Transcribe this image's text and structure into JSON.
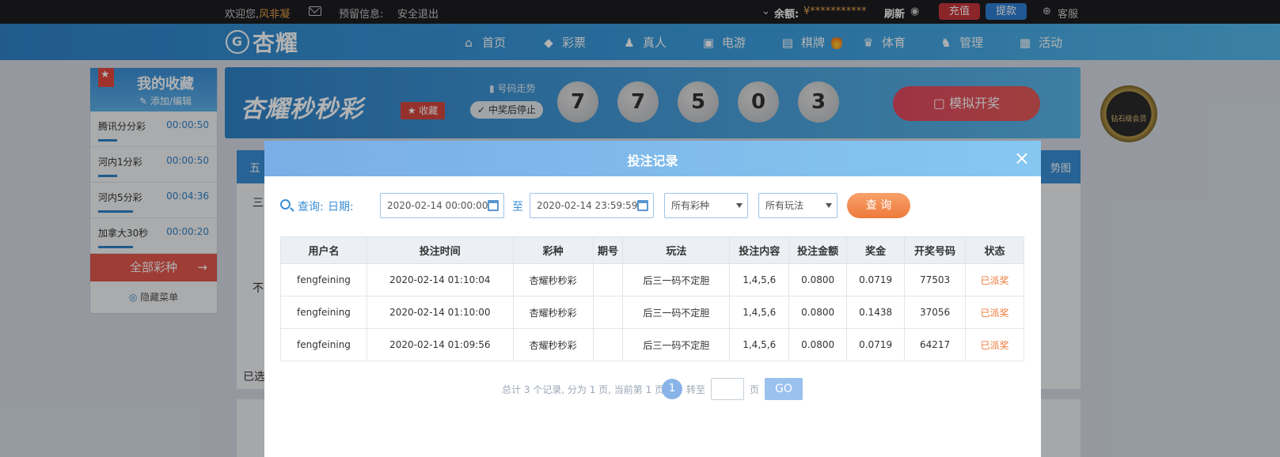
{
  "topbar": {
    "welcome": "欢迎您,",
    "username": "风非凝",
    "reserve_info": "预留信息:",
    "logout": "安全退出",
    "balance_label": "余额:",
    "balance_value": "¥***********",
    "refresh": "刷新",
    "recharge": "充值",
    "withdraw": "提款",
    "service": "客服"
  },
  "nav": {
    "logo": "杏耀",
    "items": [
      {
        "label": "首页",
        "icon": "home-icon"
      },
      {
        "label": "彩票",
        "icon": "lottery-icon"
      },
      {
        "label": "真人",
        "icon": "live-icon"
      },
      {
        "label": "电游",
        "icon": "slot-icon"
      },
      {
        "label": "棋牌",
        "icon": "card-icon"
      },
      {
        "label": "体育",
        "icon": "trophy-icon"
      },
      {
        "label": "管理",
        "icon": "users-icon"
      },
      {
        "label": "活动",
        "icon": "gift-icon"
      }
    ]
  },
  "favorites": {
    "title": "我的收藏",
    "edit": "添加/编辑",
    "items": [
      {
        "name": "腾讯分分彩",
        "time": "00:00:50"
      },
      {
        "name": "河内1分彩",
        "time": "00:00:50"
      },
      {
        "name": "河内5分彩",
        "time": "00:04:36"
      },
      {
        "name": "加拿大30秒",
        "time": "00:00:20"
      }
    ],
    "all_games": "全部彩种",
    "hide_menu": "隐藏菜单"
  },
  "banner": {
    "title": "杏耀秒秒彩",
    "fav_button": "收藏",
    "trend": "号码走势",
    "stop_toggle": "中奖后停止",
    "balls": [
      "7",
      "7",
      "5",
      "0",
      "3"
    ],
    "simulate": "模拟开奖",
    "vip_badge": "钻石级会员"
  },
  "background": {
    "tab_left": "五",
    "tab_right": "势图",
    "row1": "三",
    "row2": "不",
    "row3": "已选"
  },
  "modal": {
    "title": "投注记录",
    "close": "×",
    "filter": {
      "query_label": "查询:",
      "date_label": "日期:",
      "start": "2020-02-14 00:00:00",
      "to": "至",
      "end": "2020-02-14 23:59:59",
      "game_select": "所有彩种",
      "play_select": "所有玩法",
      "query_button": "查 询"
    },
    "table": {
      "headers": [
        "用户名",
        "投注时间",
        "彩种",
        "期号",
        "玩法",
        "投注内容",
        "投注金额",
        "奖金",
        "开奖号码",
        "状态"
      ],
      "rows": [
        [
          "fengfeining",
          "2020-02-14 01:10:04",
          "杏耀秒秒彩",
          "",
          "后三一码不定胆",
          "1,4,5,6",
          "0.0800",
          "0.0719",
          "77503",
          "已派奖"
        ],
        [
          "fengfeining",
          "2020-02-14 01:10:00",
          "杏耀秒秒彩",
          "",
          "后三一码不定胆",
          "1,4,5,6",
          "0.0800",
          "0.1438",
          "37056",
          "已派奖"
        ],
        [
          "fengfeining",
          "2020-02-14 01:09:56",
          "杏耀秒秒彩",
          "",
          "后三一码不定胆",
          "1,4,5,6",
          "0.0800",
          "0.0719",
          "64217",
          "已派奖"
        ]
      ]
    },
    "pager": {
      "summary": "总计 3 个记录, 分为 1 页, 当前第 1 页",
      "current": "1",
      "jump_to": "转至",
      "unit": "页",
      "go": "GO"
    }
  }
}
